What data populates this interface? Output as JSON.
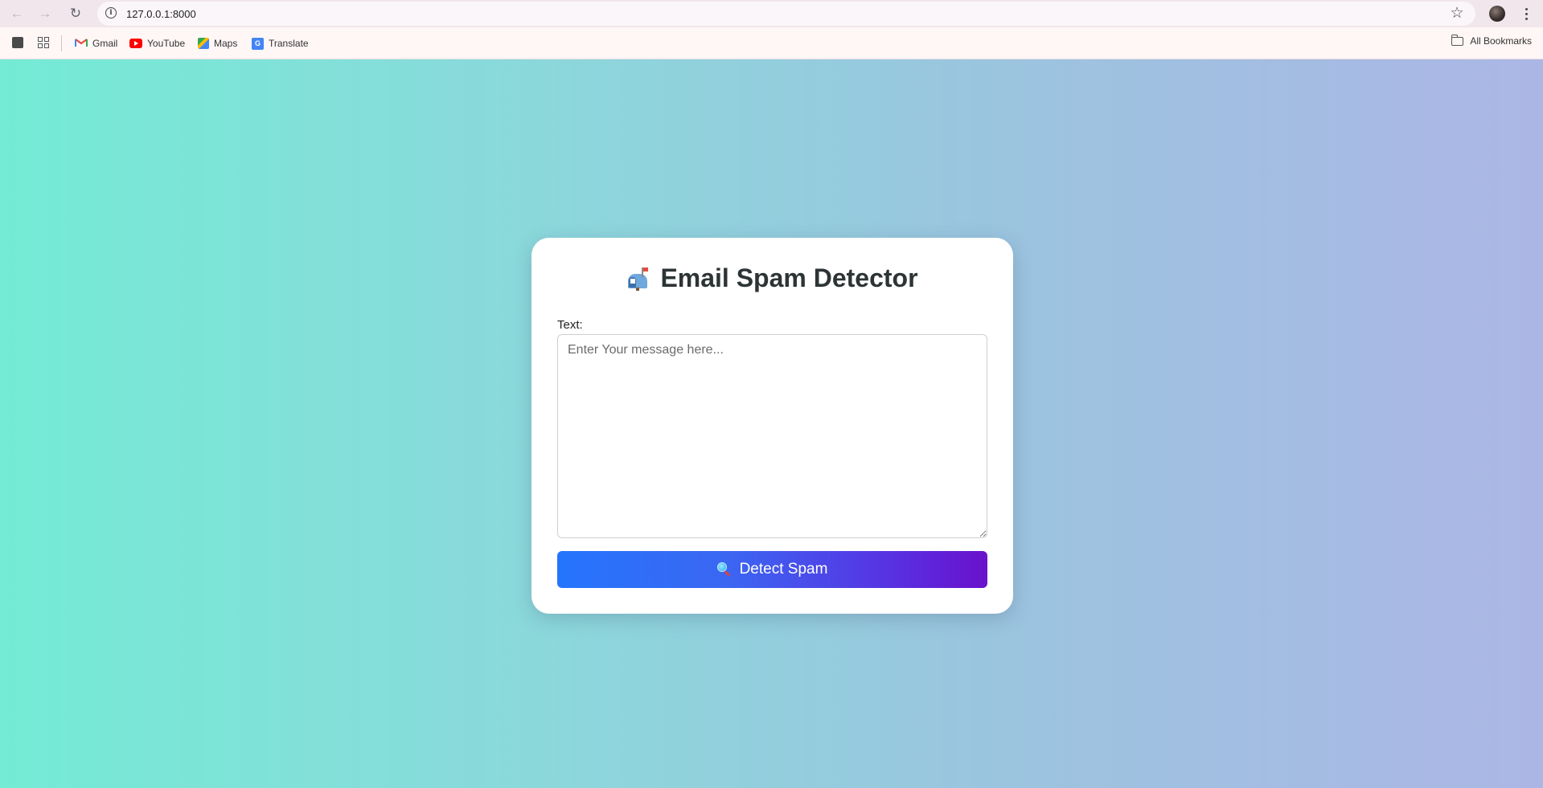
{
  "browser": {
    "url": "127.0.0.1:8000",
    "bookmarks": [
      {
        "label": "Gmail",
        "icon": "gmail-icon"
      },
      {
        "label": "YouTube",
        "icon": "youtube-icon"
      },
      {
        "label": "Maps",
        "icon": "maps-icon"
      },
      {
        "label": "Translate",
        "icon": "translate-icon"
      }
    ],
    "all_bookmarks_label": "All Bookmarks"
  },
  "app": {
    "title": "Email Spam Detector",
    "title_icon": "mailbox-icon",
    "text_label": "Text:",
    "textarea_placeholder": "Enter Your message here...",
    "textarea_value": "",
    "detect_button_label": "Detect Spam",
    "detect_button_icon": "magnifier-icon"
  },
  "colors": {
    "background_gradient_start": "#74ebd5",
    "background_gradient_end": "#acb6e5",
    "button_gradient_start": "#2575fc",
    "button_gradient_end": "#6a11cb",
    "title_color": "#2d3436"
  }
}
